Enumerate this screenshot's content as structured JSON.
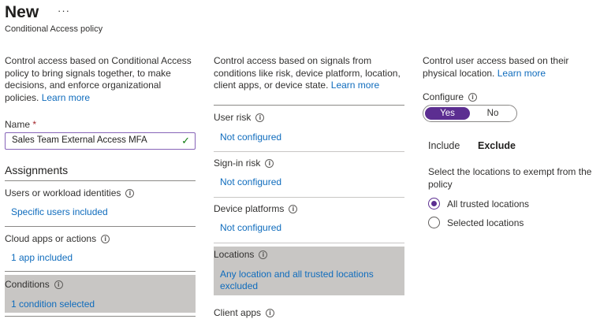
{
  "header": {
    "title": "New",
    "more_label": "···",
    "subtitle": "Conditional Access policy"
  },
  "left": {
    "description": "Control access based on Conditional Access policy to bring signals together, to make decisions, and enforce organizational policies.",
    "learn_more": "Learn more",
    "name_label": "Name",
    "required_mark": "*",
    "name_value": "Sales Team External Access MFA",
    "assignments_heading": "Assignments",
    "items": [
      {
        "label": "Users or workload identities",
        "value": "Specific users included"
      },
      {
        "label": "Cloud apps or actions",
        "value": "1 app included"
      },
      {
        "label": "Conditions",
        "value": "1 condition selected"
      }
    ]
  },
  "middle": {
    "description": "Control access based on signals from conditions like risk, device platform, location, client apps, or device state.",
    "learn_more": "Learn more",
    "items": [
      {
        "label": "User risk",
        "value": "Not configured"
      },
      {
        "label": "Sign-in risk",
        "value": "Not configured"
      },
      {
        "label": "Device platforms",
        "value": "Not configured"
      },
      {
        "label": "Locations",
        "value_line1": "Any location and all trusted locations",
        "value_line2": "excluded"
      },
      {
        "label": "Client apps"
      }
    ]
  },
  "right": {
    "description": "Control user access based on their physical location.",
    "learn_more": "Learn more",
    "configure_label": "Configure",
    "toggle_yes": "Yes",
    "toggle_no": "No",
    "tabs": [
      "Include",
      "Exclude"
    ],
    "active_tab": "Exclude",
    "exclude_description": "Select the locations to exempt from the policy",
    "options": [
      {
        "label": "All trusted locations",
        "selected": true
      },
      {
        "label": "Selected locations",
        "selected": false
      }
    ]
  },
  "colors": {
    "accent": "#5c2e91",
    "link": "#0f6cbd",
    "selected_row": "#c8c6c4"
  },
  "icons": {
    "info": "info-icon",
    "check": "checkmark-icon",
    "more": "more-icon"
  }
}
